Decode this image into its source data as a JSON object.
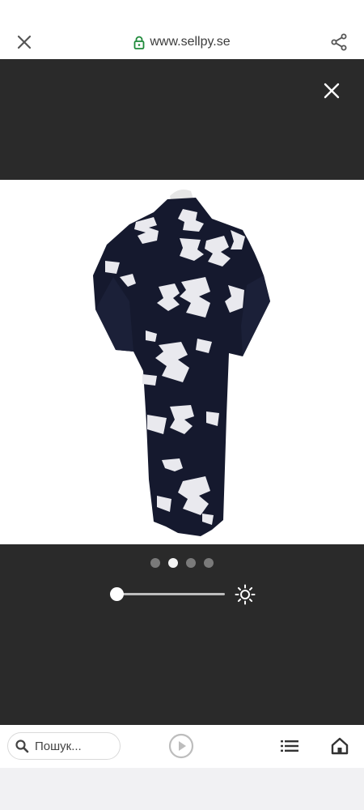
{
  "browser": {
    "url": "www.sellpy.se",
    "icons": {
      "close": "close-icon",
      "lock": "lock-icon",
      "share": "share-icon"
    }
  },
  "viewer": {
    "image_description_icon": "kimono-product-photo",
    "dots": {
      "count": 4,
      "active_index": 1
    },
    "brightness": {
      "value": 0
    }
  },
  "bottom_bar": {
    "search_placeholder": "Пошук...",
    "icons": {
      "search": "search-icon",
      "play": "play-icon",
      "list": "list-icon",
      "home": "home-icon"
    }
  },
  "colors": {
    "lock_green": "#1f8a3a",
    "viewer_bg": "#2a2a2a"
  }
}
